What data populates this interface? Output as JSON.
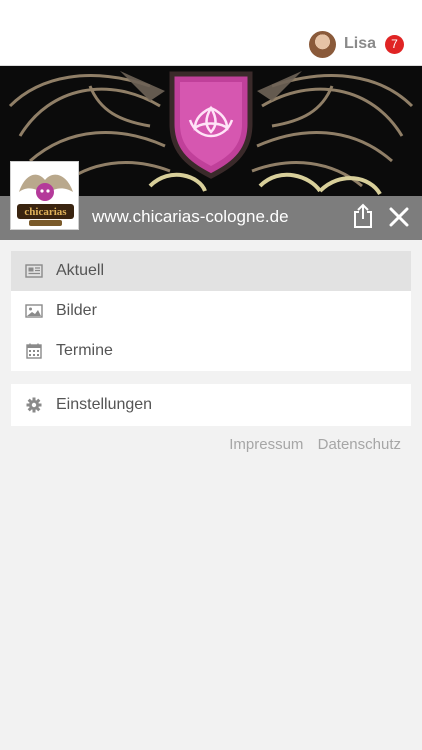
{
  "user": {
    "name": "Lisa",
    "notifications": "7"
  },
  "site": {
    "url": "www.chicarias-cologne.de",
    "logo_text": "chicarias"
  },
  "menu": {
    "items": [
      {
        "label": "Aktuell",
        "icon": "news-icon",
        "active": true
      },
      {
        "label": "Bilder",
        "icon": "image-icon"
      },
      {
        "label": "Termine",
        "icon": "calendar-icon"
      }
    ],
    "settings": {
      "label": "Einstellungen",
      "icon": "gear-icon"
    }
  },
  "footer": {
    "impressum": "Impressum",
    "datenschutz": "Datenschutz"
  },
  "colors": {
    "badge": "#e02424",
    "urlbar": "#7d7d7d",
    "active_row": "#e2e2e2"
  }
}
